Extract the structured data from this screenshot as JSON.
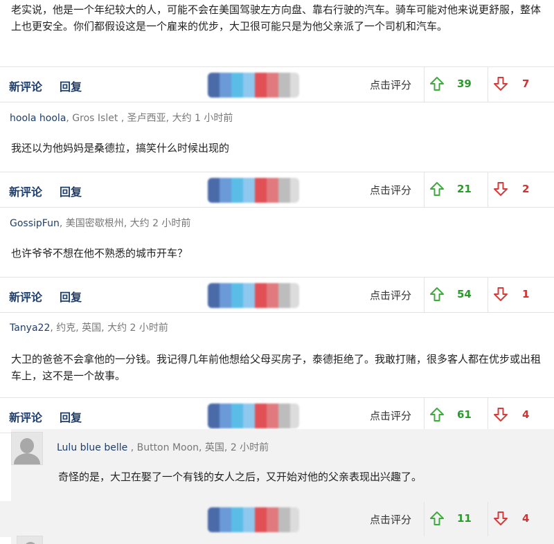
{
  "top_comment": {
    "body": "老实说，他是一个年纪较大的人，可能不会在美国驾驶左方向盘、靠右行驶的汽车。骑车可能对他来说更舒服，整体上也更安全。你们都假设这是一个雇来的优步，大卫很可能只是为他父亲派了一个司机和汽车。",
    "up": "39",
    "down": "7"
  },
  "actions": {
    "new_comment": "新评论",
    "reply": "回复",
    "rate": "点击评分"
  },
  "comments": [
    {
      "user": "hoola hoola",
      "location": ", Gros Islet , 圣卢西亚, 大约 1 小时前",
      "body": "我还以为他妈妈是桑德拉，搞笑什么时候出现的",
      "up": "21",
      "down": "2"
    },
    {
      "user": "GossipFun",
      "location": ", 美国密歇根州, 大约 2 小时前",
      "body": "也许爷爷不想在他不熟悉的城市开车？",
      "up": "54",
      "down": "1"
    },
    {
      "user": "Tanya22",
      "location": ", 约克, 英国, 大约 2 小时前",
      "body": "大卫的爸爸不会拿他的一分钱。我记得几年前他想给父母买房子，泰德拒绝了。我敢打赌，很多客人都在优步或出租车上，这不是一个故事。",
      "up": "61",
      "down": "4"
    }
  ],
  "reply": {
    "user": "Lulu blue belle",
    "location": " , Button Moon, 英国, 2 小时前",
    "body": "奇怪的是，大卫在娶了一个有钱的女人之后，又开始对他的父亲表现出兴趣了。",
    "up": "11",
    "down": "4"
  },
  "colors": {
    "username": "#1d3d6b",
    "up": "#2b9a2b",
    "down": "#d23232",
    "share_blur": [
      "#4a6aa8",
      "#6a9ad8",
      "#5abde8",
      "#e05055",
      "#e07a7e",
      "#bdbdbd",
      "#dcdcdc"
    ]
  },
  "icons": {
    "up": "arrow-up-outline-icon",
    "down": "arrow-down-outline-icon",
    "share": "blurred-share-buttons",
    "avatar": "default-user-avatar-icon"
  }
}
